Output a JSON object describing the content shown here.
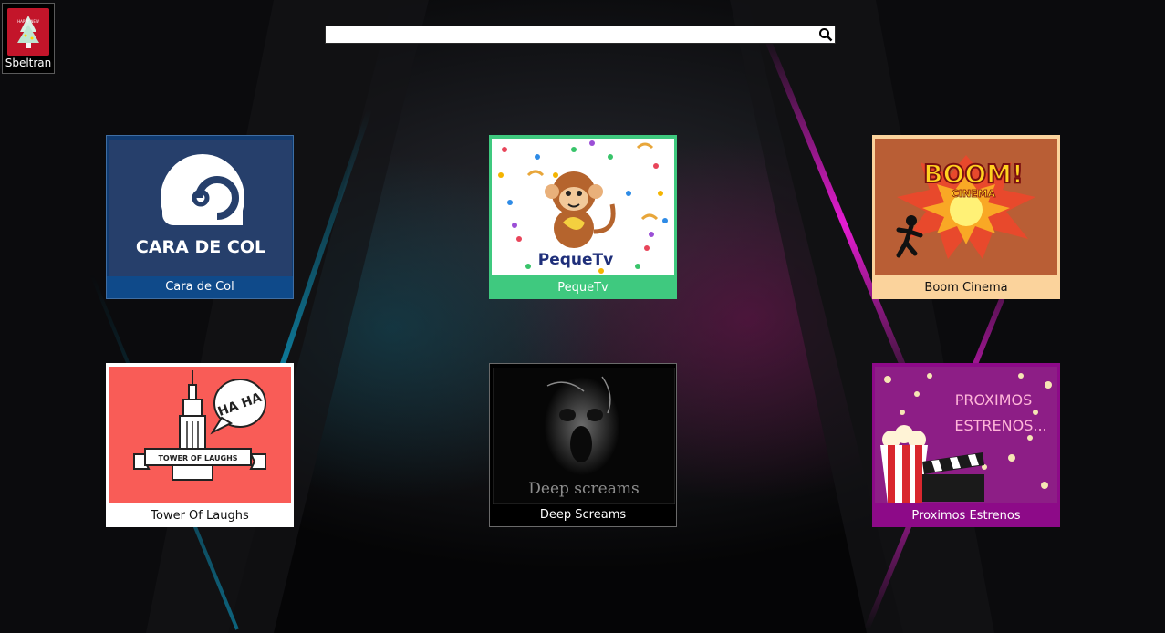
{
  "user": {
    "name": "Sbeltran",
    "avatar_icon": "christmas-tree-avatar-icon",
    "avatar_caption": "HAPPY NEW"
  },
  "search": {
    "placeholder": "",
    "value": "",
    "icon": "search-icon"
  },
  "tiles": [
    {
      "label": "Cara de Col",
      "logo_text": "CARA DE COL",
      "icon": "spiral-logo-icon",
      "accent": "#0f4a8a"
    },
    {
      "label": "PequeTv",
      "logo_text": "PequeTv",
      "icon": "monkey-icon",
      "accent": "#3fc97f"
    },
    {
      "label": "Boom Cinema",
      "logo_text": "BOOM!",
      "logo_subtext": "CINEMA",
      "icon": "explosion-icon",
      "accent": "#fbd39c"
    },
    {
      "label": "Tower Of Laughs",
      "logo_text": "TOWER OF LAUGHS",
      "bubble_text": "HA HA",
      "icon": "tower-icon",
      "accent": "#ffffff"
    },
    {
      "label": "Deep Screams",
      "logo_text": "Deep screams",
      "icon": "screaming-face-icon",
      "accent": "#000000"
    },
    {
      "label": "Proximos Estrenos",
      "logo_text": "PROXIMOS",
      "logo_subtext": "ESTRENOS...",
      "icon": "popcorn-clapperboard-icon",
      "accent": "#8d0a88"
    }
  ],
  "colors": {
    "background": "#050506",
    "neon_blue": "#1fb6d6",
    "neon_pink": "#e21ad8"
  }
}
